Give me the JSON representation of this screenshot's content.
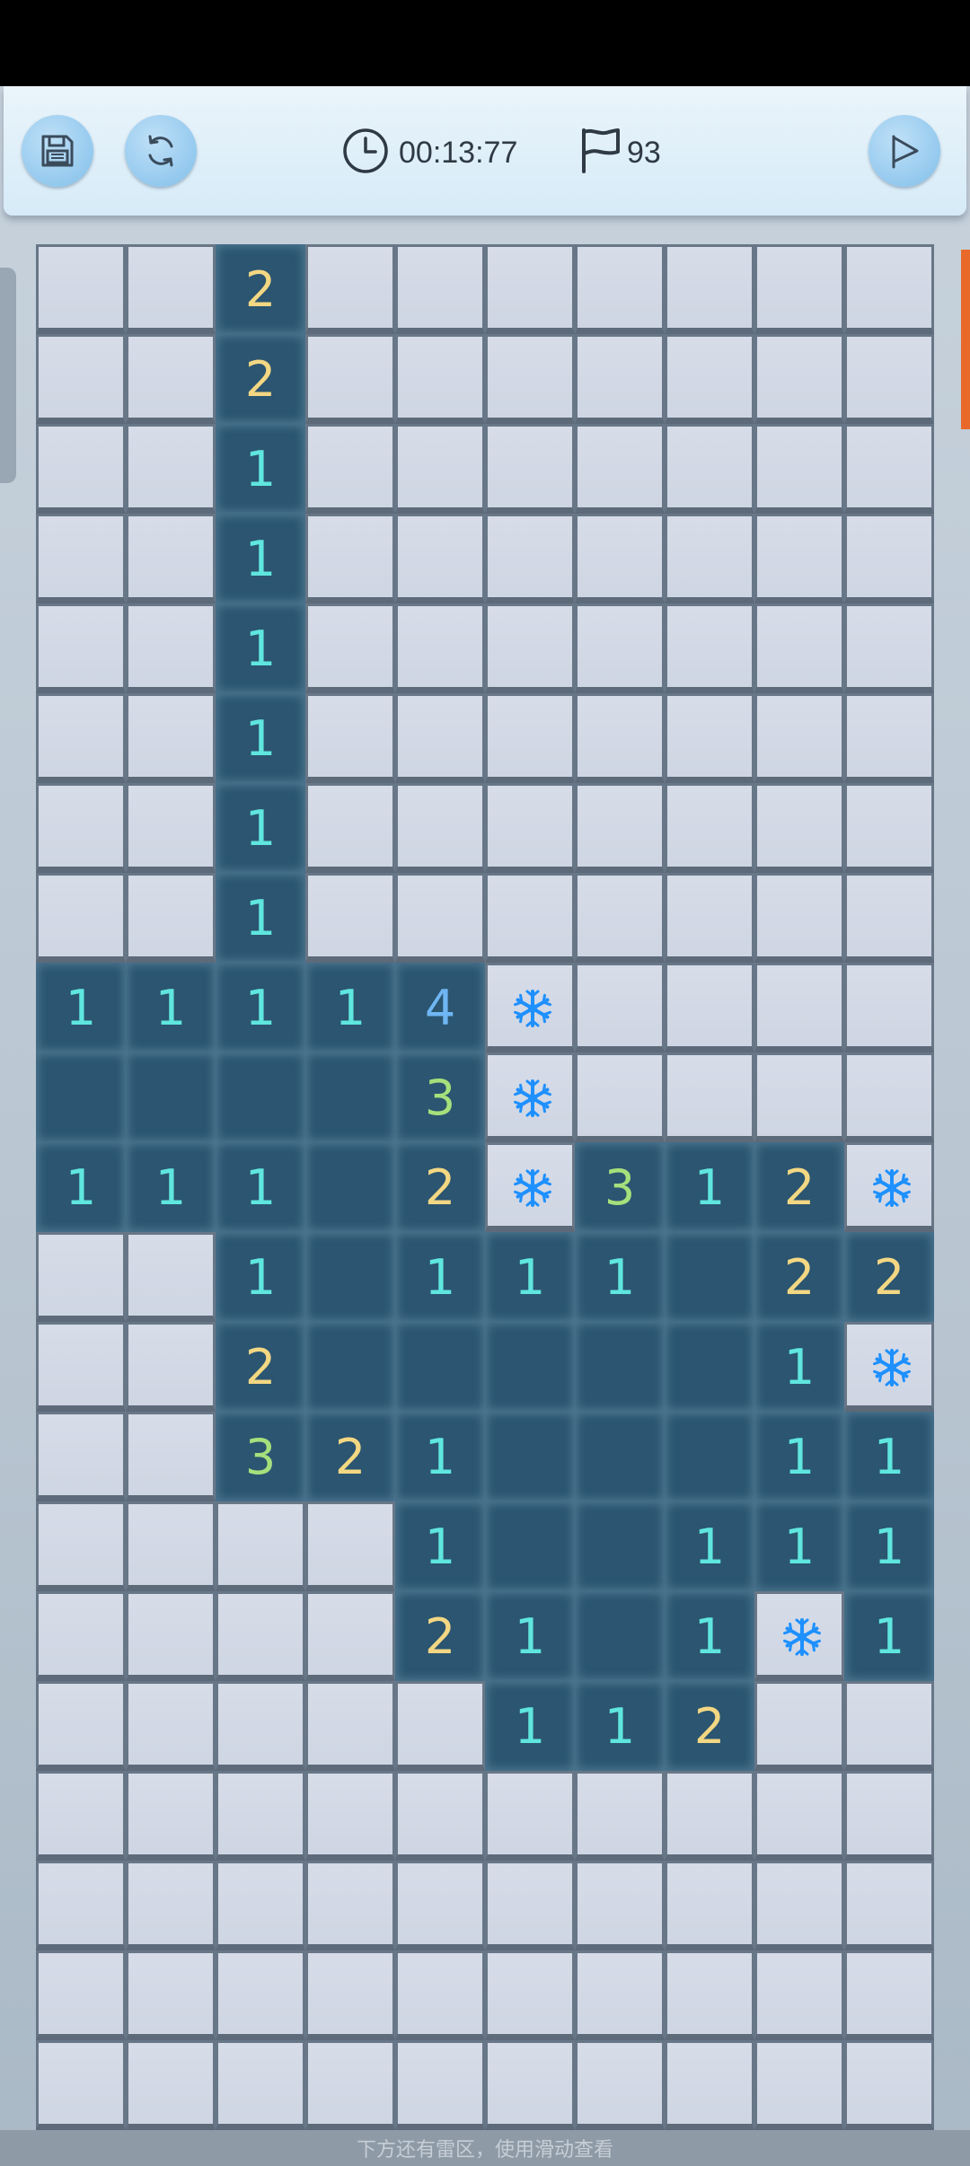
{
  "toolbar": {
    "save_icon": "save-icon",
    "restart_icon": "restart-icon",
    "timer_icon": "clock-icon",
    "timer_value": "00:13:77",
    "flag_icon": "flag-icon",
    "flags_count": "93",
    "play_icon": "play-icon"
  },
  "board": {
    "columns": 10,
    "rows_visible": 21,
    "legend": "C = covered, O = opened empty, M = snowflake marked, digits = opened with count",
    "rows": [
      [
        "C",
        "C",
        "2",
        "C",
        "C",
        "C",
        "C",
        "C",
        "C",
        "C"
      ],
      [
        "C",
        "C",
        "2",
        "C",
        "C",
        "C",
        "C",
        "C",
        "C",
        "C"
      ],
      [
        "C",
        "C",
        "1",
        "C",
        "C",
        "C",
        "C",
        "C",
        "C",
        "C"
      ],
      [
        "C",
        "C",
        "1",
        "C",
        "C",
        "C",
        "C",
        "C",
        "C",
        "C"
      ],
      [
        "C",
        "C",
        "1",
        "C",
        "C",
        "C",
        "C",
        "C",
        "C",
        "C"
      ],
      [
        "C",
        "C",
        "1",
        "C",
        "C",
        "C",
        "C",
        "C",
        "C",
        "C"
      ],
      [
        "C",
        "C",
        "1",
        "C",
        "C",
        "C",
        "C",
        "C",
        "C",
        "C"
      ],
      [
        "C",
        "C",
        "1",
        "C",
        "C",
        "C",
        "C",
        "C",
        "C",
        "C"
      ],
      [
        "1",
        "1",
        "1",
        "1",
        "4",
        "M",
        "C",
        "C",
        "C",
        "C"
      ],
      [
        "O",
        "O",
        "O",
        "O",
        "3",
        "M",
        "C",
        "C",
        "C",
        "C"
      ],
      [
        "1",
        "1",
        "1",
        "O",
        "2",
        "M",
        "3",
        "1",
        "2",
        "M"
      ],
      [
        "C",
        "C",
        "1",
        "O",
        "1",
        "1",
        "1",
        "O",
        "2",
        "2"
      ],
      [
        "C",
        "C",
        "2",
        "O",
        "O",
        "O",
        "O",
        "O",
        "1",
        "M"
      ],
      [
        "C",
        "C",
        "3",
        "2",
        "1",
        "O",
        "O",
        "O",
        "1",
        "1"
      ],
      [
        "C",
        "C",
        "C",
        "C",
        "1",
        "O",
        "O",
        "1",
        "1",
        "1"
      ],
      [
        "C",
        "C",
        "C",
        "C",
        "2",
        "1",
        "O",
        "1",
        "M",
        "1"
      ],
      [
        "C",
        "C",
        "C",
        "C",
        "C",
        "1",
        "1",
        "2",
        "C",
        "C"
      ],
      [
        "C",
        "C",
        "C",
        "C",
        "C",
        "C",
        "C",
        "C",
        "C",
        "C"
      ],
      [
        "C",
        "C",
        "C",
        "C",
        "C",
        "C",
        "C",
        "C",
        "C",
        "C"
      ],
      [
        "C",
        "C",
        "C",
        "C",
        "C",
        "C",
        "C",
        "C",
        "C",
        "C"
      ],
      [
        "C",
        "C",
        "C",
        "C",
        "C",
        "C",
        "C",
        "C",
        "C",
        "C"
      ]
    ]
  },
  "colors": {
    "open_cell": "#2b5570",
    "covered_cell": "#d3d9e6",
    "number_1": "#5fe6df",
    "number_2": "#f3d783",
    "number_3": "#a6e07c",
    "number_4": "#6fb6f3",
    "snowflake": "#1e90ff",
    "accent_bar": "#e8692a"
  },
  "footer": {
    "hint": "下方还有雷区，使用滑动查看"
  }
}
